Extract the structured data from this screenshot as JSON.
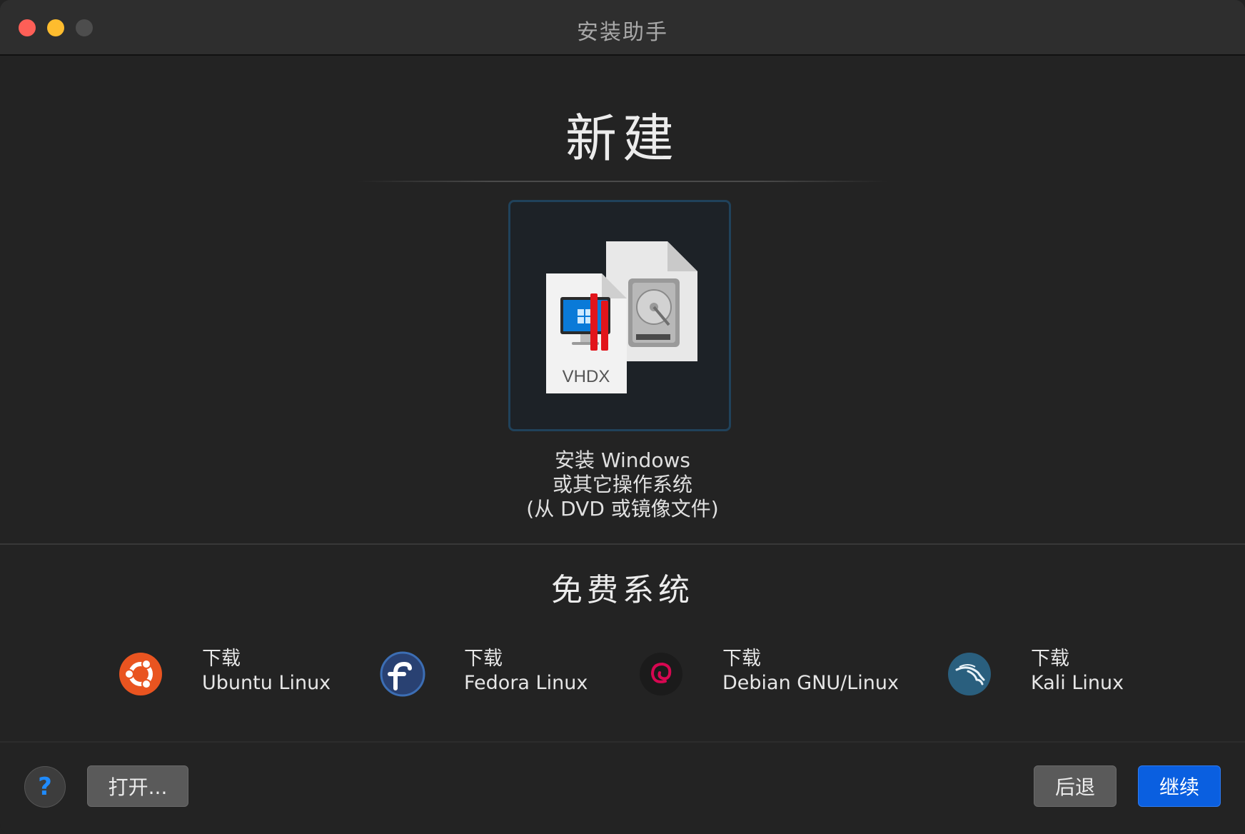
{
  "window": {
    "title": "安装助手"
  },
  "new_section": {
    "heading": "新建",
    "install_tile": {
      "badge": "VHDX",
      "caption_line1": "安装 Windows",
      "caption_line2": "或其它操作系统",
      "caption_line3": "(从 DVD 或镜像文件)"
    }
  },
  "free_section": {
    "heading": "免费系统",
    "items": [
      {
        "action": "下载",
        "name": "Ubuntu Linux",
        "icon": "ubuntu-icon"
      },
      {
        "action": "下载",
        "name": "Fedora Linux",
        "icon": "fedora-icon"
      },
      {
        "action": "下载",
        "name": "Debian GNU/Linux",
        "icon": "debian-icon"
      },
      {
        "action": "下载",
        "name": "Kali Linux",
        "icon": "kali-icon"
      }
    ]
  },
  "footer": {
    "help_label": "?",
    "open_label": "打开...",
    "back_label": "后退",
    "continue_label": "继续"
  },
  "colors": {
    "background": "#232323",
    "accent": "#0a5fe0",
    "close": "#fe5f57",
    "minimize": "#febc2e"
  }
}
